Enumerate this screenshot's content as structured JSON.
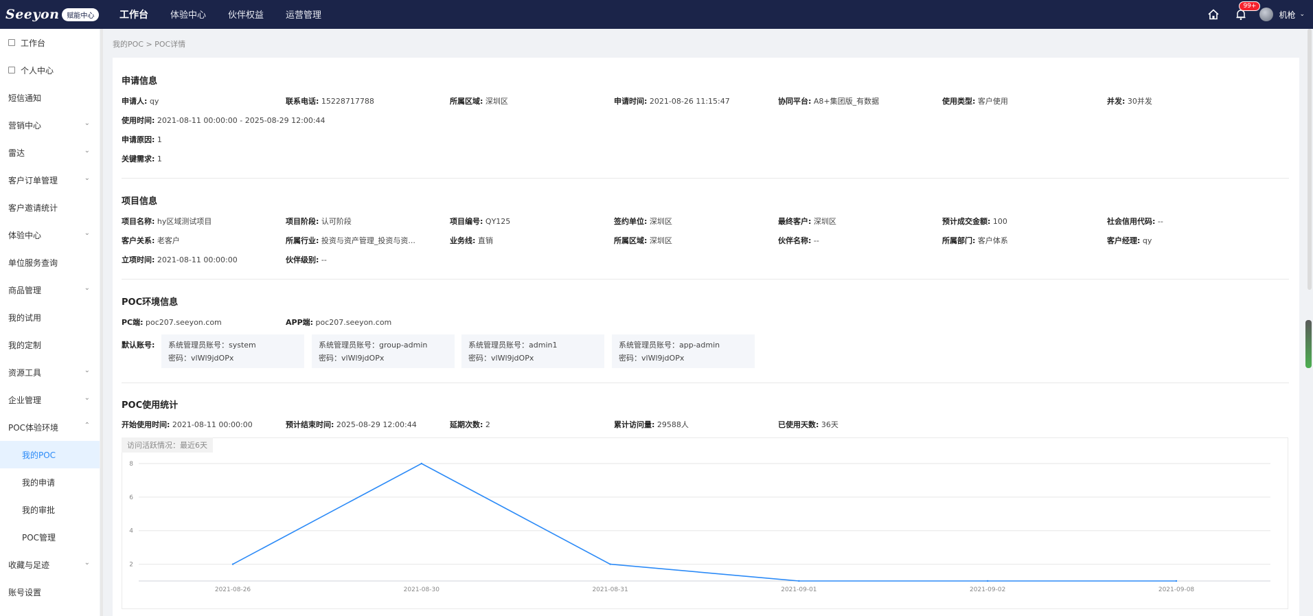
{
  "brand": {
    "logo": "Seeyon",
    "badge": "赋能中心"
  },
  "topnav": [
    "工作台",
    "体验中心",
    "伙伴权益",
    "运营管理"
  ],
  "topbar": {
    "notifications": "99+",
    "username": "机枪"
  },
  "sidebar": {
    "items": [
      {
        "label": "工作台"
      },
      {
        "label": "个人中心"
      },
      {
        "label": "短信通知"
      },
      {
        "label": "营销中心"
      },
      {
        "label": "雷达"
      },
      {
        "label": "客户订单管理"
      },
      {
        "label": "客户邀请统计"
      },
      {
        "label": "体验中心"
      },
      {
        "label": "单位服务查询"
      },
      {
        "label": "商品管理"
      },
      {
        "label": "我的试用"
      },
      {
        "label": "我的定制"
      },
      {
        "label": "资源工具"
      },
      {
        "label": "企业管理"
      },
      {
        "label": "POC体验环境"
      },
      {
        "label": "我的POC"
      },
      {
        "label": "我的申请"
      },
      {
        "label": "我的审批"
      },
      {
        "label": "POC管理"
      },
      {
        "label": "收藏与足迹"
      },
      {
        "label": "账号设置"
      }
    ]
  },
  "breadcrumb": "我的POC > POC详情",
  "apply": {
    "title": "申请信息",
    "fields": [
      {
        "label": "申请人:",
        "value": "qy"
      },
      {
        "label": "联系电话:",
        "value": "15228717788"
      },
      {
        "label": "所属区域:",
        "value": "深圳区"
      },
      {
        "label": "申请时间:",
        "value": "2021-08-26 11:15:47"
      },
      {
        "label": "协同平台:",
        "value": "A8+集团版_有数据"
      },
      {
        "label": "使用类型:",
        "value": "客户使用"
      },
      {
        "label": "并发:",
        "value": "30并发"
      },
      {
        "label": "使用时间:",
        "value": "2021-08-11 00:00:00 - 2025-08-29 12:00:44"
      },
      {
        "label": "申请原因:",
        "value": "1"
      },
      {
        "label": "关键需求:",
        "value": "1"
      }
    ]
  },
  "project": {
    "title": "项目信息",
    "fields": [
      {
        "label": "项目名称:",
        "value": "hy区域测试项目"
      },
      {
        "label": "项目阶段:",
        "value": "认可阶段"
      },
      {
        "label": "项目编号:",
        "value": "QY125"
      },
      {
        "label": "签约单位:",
        "value": "深圳区"
      },
      {
        "label": "最终客户:",
        "value": "深圳区"
      },
      {
        "label": "预计成交金额:",
        "value": "100"
      },
      {
        "label": "社会信用代码:",
        "value": "--"
      },
      {
        "label": "客户关系:",
        "value": "老客户"
      },
      {
        "label": "所属行业:",
        "value": "投资与资产管理_投资与资..."
      },
      {
        "label": "业务线:",
        "value": "直销"
      },
      {
        "label": "所属区域:",
        "value": "深圳区"
      },
      {
        "label": "伙伴名称:",
        "value": "--"
      },
      {
        "label": "所属部门:",
        "value": "客户体系"
      },
      {
        "label": "客户经理:",
        "value": "qy"
      },
      {
        "label": "立项时间:",
        "value": "2021-08-11 00:00:00"
      },
      {
        "label": "伙伴级别:",
        "value": "--"
      }
    ]
  },
  "poc_env": {
    "title": "POC环境信息",
    "pc_label": "PC端:",
    "pc_value": "poc207.seeyon.com",
    "app_label": "APP端:",
    "app_value": "poc207.seeyon.com",
    "accounts_label": "默认账号:",
    "accounts": [
      {
        "line1": "系统管理员账号：system",
        "line2": "密码：vlWl9jdOPx"
      },
      {
        "line1": "系统管理员账号：group-admin",
        "line2": "密码：vlWl9jdOPx"
      },
      {
        "line1": "系统管理员账号：admin1",
        "line2": "密码：vlWl9jdOPx"
      },
      {
        "line1": "系统管理员账号：app-admin",
        "line2": "密码：vlWl9jdOPx"
      }
    ]
  },
  "stats": {
    "title": "POC使用统计",
    "fields": [
      {
        "label": "开始使用时间:",
        "value": "2021-08-11 00:00:00"
      },
      {
        "label": "预计结束时间:",
        "value": "2025-08-29 12:00:44"
      },
      {
        "label": "延期次数:",
        "value": "2"
      },
      {
        "label": "累计访问量:",
        "value": "29588人"
      },
      {
        "label": "已使用天数:",
        "value": "36天"
      }
    ]
  },
  "chart_data": {
    "type": "line",
    "title": "访问活跃情况：最近6天",
    "categories": [
      "2021-08-26",
      "2021-08-30",
      "2021-08-31",
      "2021-09-01",
      "2021-09-02",
      "2021-09-08"
    ],
    "values": [
      2,
      8,
      2,
      1,
      1,
      1
    ],
    "yticks": [
      2,
      4,
      6,
      8
    ],
    "ylim": [
      1,
      8
    ],
    "grid": true,
    "color": "#2b8af7"
  },
  "colors": {
    "topbar": "#1b2449",
    "accent": "#2b8af7",
    "badge": "#f5222d"
  }
}
